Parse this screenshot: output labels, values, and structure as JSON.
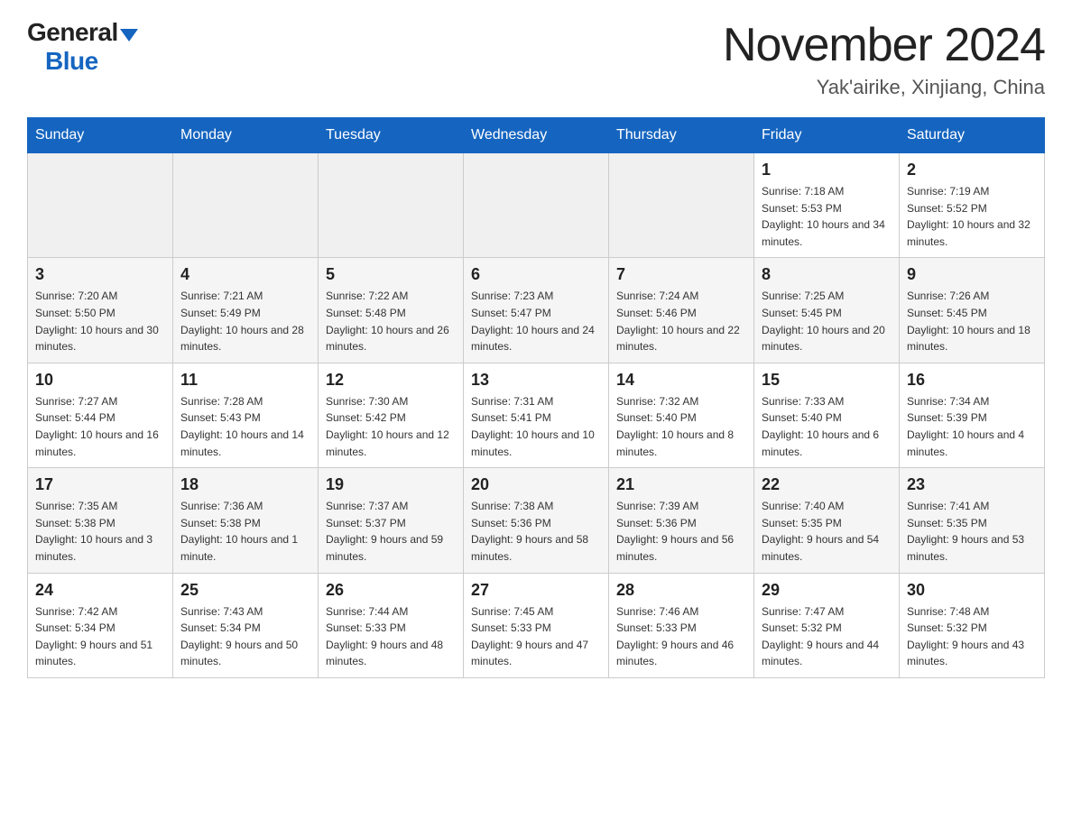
{
  "header": {
    "logo_general": "General",
    "logo_blue": "Blue",
    "month_title": "November 2024",
    "location": "Yak'airike, Xinjiang, China"
  },
  "weekdays": [
    "Sunday",
    "Monday",
    "Tuesday",
    "Wednesday",
    "Thursday",
    "Friday",
    "Saturday"
  ],
  "weeks": [
    [
      {
        "day": "",
        "empty": true
      },
      {
        "day": "",
        "empty": true
      },
      {
        "day": "",
        "empty": true
      },
      {
        "day": "",
        "empty": true
      },
      {
        "day": "",
        "empty": true
      },
      {
        "day": "1",
        "sunrise": "Sunrise: 7:18 AM",
        "sunset": "Sunset: 5:53 PM",
        "daylight": "Daylight: 10 hours and 34 minutes."
      },
      {
        "day": "2",
        "sunrise": "Sunrise: 7:19 AM",
        "sunset": "Sunset: 5:52 PM",
        "daylight": "Daylight: 10 hours and 32 minutes."
      }
    ],
    [
      {
        "day": "3",
        "sunrise": "Sunrise: 7:20 AM",
        "sunset": "Sunset: 5:50 PM",
        "daylight": "Daylight: 10 hours and 30 minutes."
      },
      {
        "day": "4",
        "sunrise": "Sunrise: 7:21 AM",
        "sunset": "Sunset: 5:49 PM",
        "daylight": "Daylight: 10 hours and 28 minutes."
      },
      {
        "day": "5",
        "sunrise": "Sunrise: 7:22 AM",
        "sunset": "Sunset: 5:48 PM",
        "daylight": "Daylight: 10 hours and 26 minutes."
      },
      {
        "day": "6",
        "sunrise": "Sunrise: 7:23 AM",
        "sunset": "Sunset: 5:47 PM",
        "daylight": "Daylight: 10 hours and 24 minutes."
      },
      {
        "day": "7",
        "sunrise": "Sunrise: 7:24 AM",
        "sunset": "Sunset: 5:46 PM",
        "daylight": "Daylight: 10 hours and 22 minutes."
      },
      {
        "day": "8",
        "sunrise": "Sunrise: 7:25 AM",
        "sunset": "Sunset: 5:45 PM",
        "daylight": "Daylight: 10 hours and 20 minutes."
      },
      {
        "day": "9",
        "sunrise": "Sunrise: 7:26 AM",
        "sunset": "Sunset: 5:45 PM",
        "daylight": "Daylight: 10 hours and 18 minutes."
      }
    ],
    [
      {
        "day": "10",
        "sunrise": "Sunrise: 7:27 AM",
        "sunset": "Sunset: 5:44 PM",
        "daylight": "Daylight: 10 hours and 16 minutes."
      },
      {
        "day": "11",
        "sunrise": "Sunrise: 7:28 AM",
        "sunset": "Sunset: 5:43 PM",
        "daylight": "Daylight: 10 hours and 14 minutes."
      },
      {
        "day": "12",
        "sunrise": "Sunrise: 7:30 AM",
        "sunset": "Sunset: 5:42 PM",
        "daylight": "Daylight: 10 hours and 12 minutes."
      },
      {
        "day": "13",
        "sunrise": "Sunrise: 7:31 AM",
        "sunset": "Sunset: 5:41 PM",
        "daylight": "Daylight: 10 hours and 10 minutes."
      },
      {
        "day": "14",
        "sunrise": "Sunrise: 7:32 AM",
        "sunset": "Sunset: 5:40 PM",
        "daylight": "Daylight: 10 hours and 8 minutes."
      },
      {
        "day": "15",
        "sunrise": "Sunrise: 7:33 AM",
        "sunset": "Sunset: 5:40 PM",
        "daylight": "Daylight: 10 hours and 6 minutes."
      },
      {
        "day": "16",
        "sunrise": "Sunrise: 7:34 AM",
        "sunset": "Sunset: 5:39 PM",
        "daylight": "Daylight: 10 hours and 4 minutes."
      }
    ],
    [
      {
        "day": "17",
        "sunrise": "Sunrise: 7:35 AM",
        "sunset": "Sunset: 5:38 PM",
        "daylight": "Daylight: 10 hours and 3 minutes."
      },
      {
        "day": "18",
        "sunrise": "Sunrise: 7:36 AM",
        "sunset": "Sunset: 5:38 PM",
        "daylight": "Daylight: 10 hours and 1 minute."
      },
      {
        "day": "19",
        "sunrise": "Sunrise: 7:37 AM",
        "sunset": "Sunset: 5:37 PM",
        "daylight": "Daylight: 9 hours and 59 minutes."
      },
      {
        "day": "20",
        "sunrise": "Sunrise: 7:38 AM",
        "sunset": "Sunset: 5:36 PM",
        "daylight": "Daylight: 9 hours and 58 minutes."
      },
      {
        "day": "21",
        "sunrise": "Sunrise: 7:39 AM",
        "sunset": "Sunset: 5:36 PM",
        "daylight": "Daylight: 9 hours and 56 minutes."
      },
      {
        "day": "22",
        "sunrise": "Sunrise: 7:40 AM",
        "sunset": "Sunset: 5:35 PM",
        "daylight": "Daylight: 9 hours and 54 minutes."
      },
      {
        "day": "23",
        "sunrise": "Sunrise: 7:41 AM",
        "sunset": "Sunset: 5:35 PM",
        "daylight": "Daylight: 9 hours and 53 minutes."
      }
    ],
    [
      {
        "day": "24",
        "sunrise": "Sunrise: 7:42 AM",
        "sunset": "Sunset: 5:34 PM",
        "daylight": "Daylight: 9 hours and 51 minutes."
      },
      {
        "day": "25",
        "sunrise": "Sunrise: 7:43 AM",
        "sunset": "Sunset: 5:34 PM",
        "daylight": "Daylight: 9 hours and 50 minutes."
      },
      {
        "day": "26",
        "sunrise": "Sunrise: 7:44 AM",
        "sunset": "Sunset: 5:33 PM",
        "daylight": "Daylight: 9 hours and 48 minutes."
      },
      {
        "day": "27",
        "sunrise": "Sunrise: 7:45 AM",
        "sunset": "Sunset: 5:33 PM",
        "daylight": "Daylight: 9 hours and 47 minutes."
      },
      {
        "day": "28",
        "sunrise": "Sunrise: 7:46 AM",
        "sunset": "Sunset: 5:33 PM",
        "daylight": "Daylight: 9 hours and 46 minutes."
      },
      {
        "day": "29",
        "sunrise": "Sunrise: 7:47 AM",
        "sunset": "Sunset: 5:32 PM",
        "daylight": "Daylight: 9 hours and 44 minutes."
      },
      {
        "day": "30",
        "sunrise": "Sunrise: 7:48 AM",
        "sunset": "Sunset: 5:32 PM",
        "daylight": "Daylight: 9 hours and 43 minutes."
      }
    ]
  ]
}
